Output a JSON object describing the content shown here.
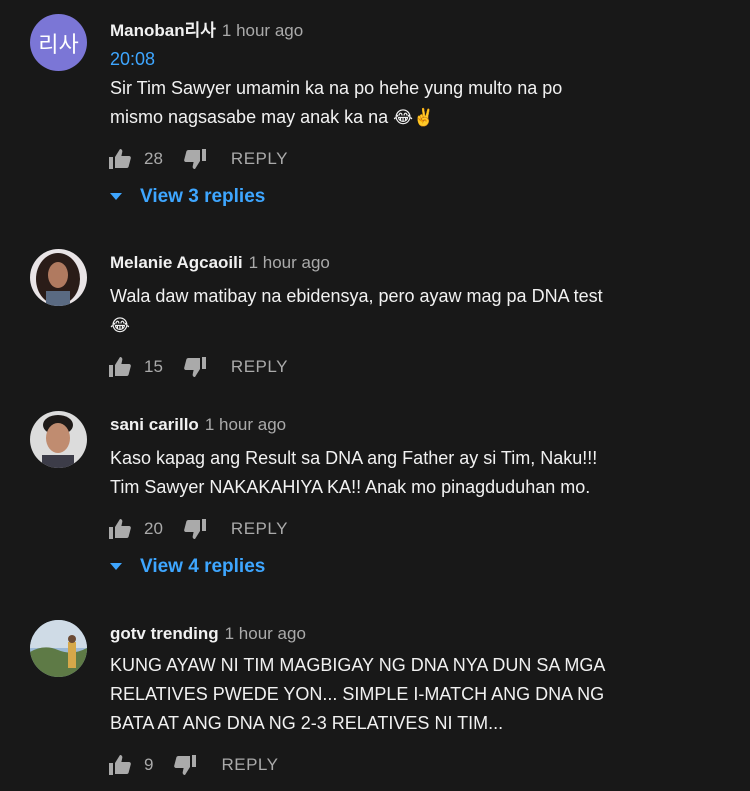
{
  "comments": [
    {
      "author": "Manoban리사",
      "time": "1 hour ago",
      "avatar_text": "리사",
      "timestamp_link": "20:08",
      "text_line1": "Sir Tim Sawyer umamin ka na po hehe yung multo na po",
      "text_line2": "mismo nagsasabe may anak ka na",
      "emoji": "😂✌️",
      "likes": "28",
      "reply_label": "REPLY",
      "replies_label": "View 3 replies"
    },
    {
      "author": "Melanie Agcaoili",
      "time": "1 hour ago",
      "text_line1": "Wala daw matibay na ebidensya, pero ayaw mag pa DNA test",
      "emoji": "😂",
      "likes": "15",
      "reply_label": "REPLY"
    },
    {
      "author": "sani carillo",
      "time": "1 hour ago",
      "text_line1": "Kaso kapag ang Result sa DNA ang Father ay si Tim, Naku!!!",
      "text_line2": "Tim Sawyer NAKAKAHIYA KA!! Anak mo pinagduduhan mo.",
      "likes": "20",
      "reply_label": "REPLY",
      "replies_label": "View 4 replies"
    },
    {
      "author": "gotv trending",
      "time": "1 hour ago",
      "text_line1": "KUNG AYAW NI TIM MAGBIGAY NG DNA NYA DUN SA MGA",
      "text_line2": "RELATIVES PWEDE YON... SIMPLE I-MATCH ANG DNA NG",
      "text_line3": "BATA AT ANG DNA NG 2-3 RELATIVES NI TIM...",
      "likes": "9",
      "reply_label": "REPLY"
    }
  ],
  "colors": {
    "background": "#181818",
    "link": "#3ea6ff",
    "muted": "#aaaaaa",
    "text": "#f1f1f1"
  }
}
